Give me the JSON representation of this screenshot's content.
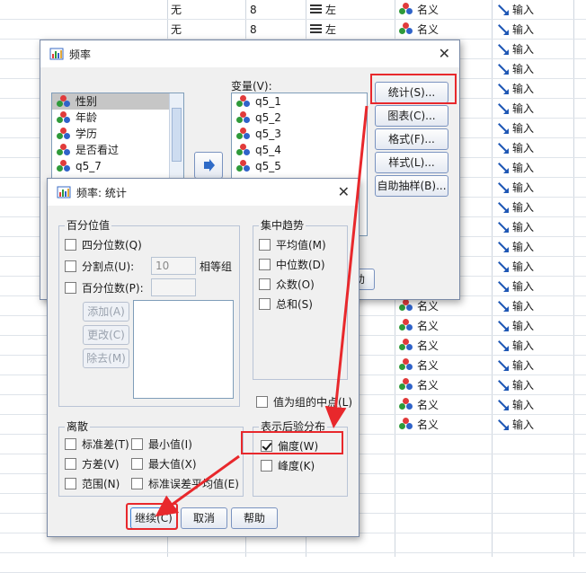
{
  "sheet": {
    "rows_top": [
      {
        "decimals": "无",
        "width": "8",
        "align": "左",
        "measure": "名义",
        "role": "输入"
      },
      {
        "decimals": "无",
        "width": "8",
        "align": "左",
        "measure": "名义",
        "role": "输入"
      }
    ],
    "measure_label": "名义",
    "role_label": "输入"
  },
  "freq_dialog": {
    "title": "频率",
    "source_vars": [
      "性别",
      "年龄",
      "学历",
      "是否看过",
      "q5_7"
    ],
    "target_label": "变量(V):",
    "target_vars": [
      "q5_1",
      "q5_2",
      "q5_3",
      "q5_4",
      "q5_5"
    ],
    "buttons": {
      "statistics": "统计(S)...",
      "charts": "图表(C)...",
      "format": "格式(F)...",
      "style": "样式(L)...",
      "bootstrap": "自助抽样(B)..."
    },
    "partial_button": "助"
  },
  "stats_dialog": {
    "title": "频率: 统计",
    "percentile": {
      "label": "百分位值",
      "quartiles": "四分位数(Q)",
      "cut_points": "分割点(U):",
      "cut_points_value": "10",
      "cut_points_suffix": "相等组",
      "percentiles": "百分位数(P):",
      "add": "添加(A)",
      "change": "更改(C)",
      "remove": "除去(M)"
    },
    "central": {
      "label": "集中趋势",
      "mean": "平均值(M)",
      "median": "中位数(D)",
      "mode": "众数(O)",
      "sum": "总和(S)"
    },
    "group_midpoints": "值为组的中点(L)",
    "dispersion": {
      "label": "离散",
      "std": "标准差(T)",
      "min": "最小值(I)",
      "variance": "方差(V)",
      "max": "最大值(X)",
      "range": "范围(N)",
      "sem": "标准误差平均值(E)"
    },
    "distribution": {
      "label": "表示后验分布",
      "skewness": "偏度(W)",
      "kurtosis": "峰度(K)",
      "skewness_checked": true
    },
    "footer": {
      "continue": "继续(C)",
      "cancel": "取消",
      "help": "帮助"
    }
  },
  "colors": {
    "highlight": "#e8282c",
    "window_bg": "#f0f0f0",
    "border": "#7a93c0"
  }
}
